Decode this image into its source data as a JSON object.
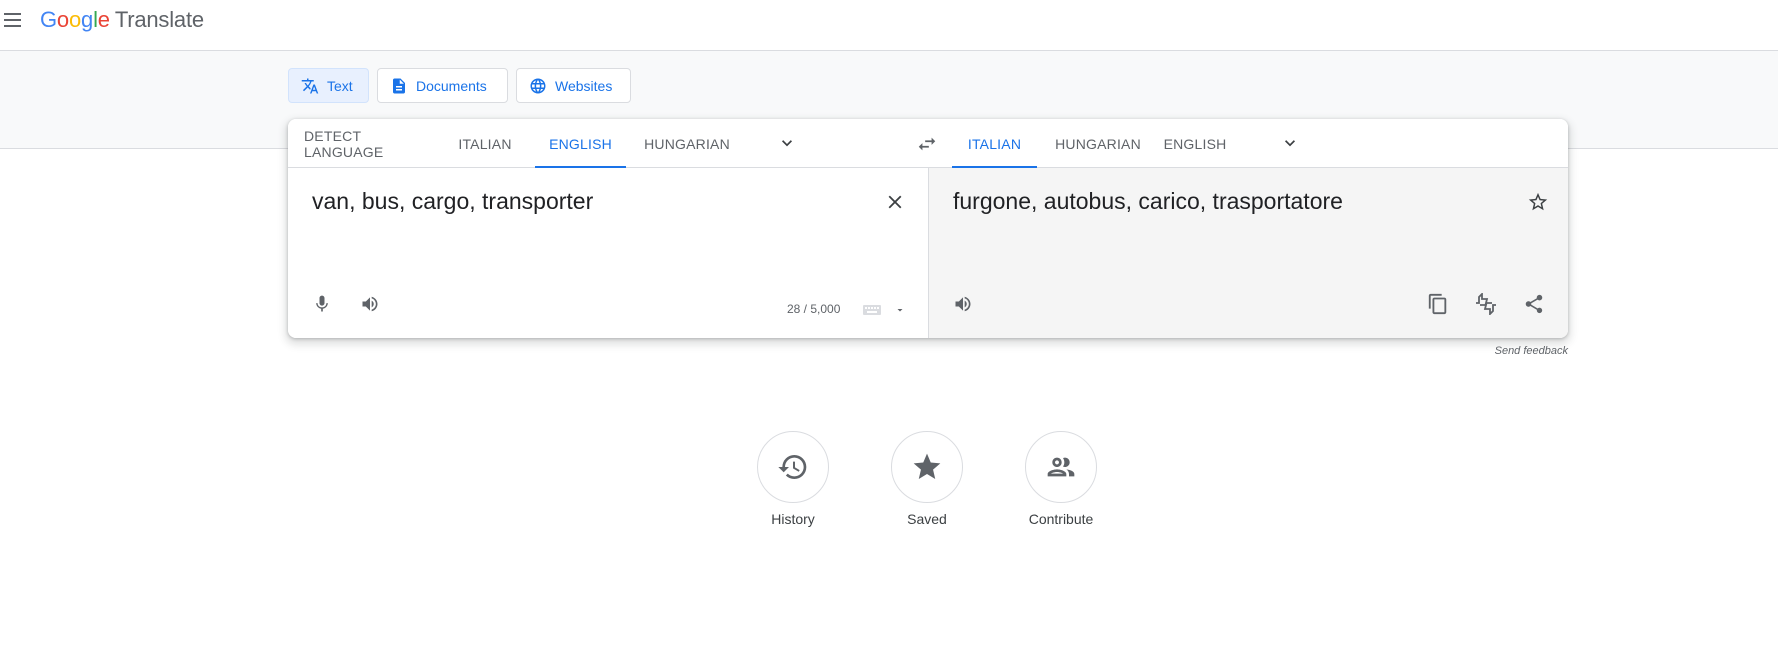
{
  "header": {
    "logo_letters": [
      "G",
      "o",
      "o",
      "g",
      "l",
      "e"
    ],
    "product": "Translate"
  },
  "modes": [
    {
      "label": "Text",
      "icon": "translate-icon"
    },
    {
      "label": "Documents",
      "icon": "document-icon"
    },
    {
      "label": "Websites",
      "icon": "globe-icon"
    }
  ],
  "source_langs": [
    "DETECT LANGUAGE",
    "ITALIAN",
    "ENGLISH",
    "HUNGARIAN"
  ],
  "source_active": "ENGLISH",
  "target_langs": [
    "ITALIAN",
    "HUNGARIAN",
    "ENGLISH"
  ],
  "target_active": "ITALIAN",
  "source": {
    "text": "van, bus, cargo, transporter",
    "char_count": "28 / 5,000"
  },
  "target": {
    "text": "furgone, autobus, carico, trasportatore"
  },
  "feedback": "Send feedback",
  "bottom": [
    {
      "label": "History",
      "icon": "history-icon"
    },
    {
      "label": "Saved",
      "icon": "star-icon"
    },
    {
      "label": "Contribute",
      "icon": "people-icon"
    }
  ],
  "colors": {
    "accent": "#1a73e8",
    "icon_grey": "#5f6368"
  }
}
